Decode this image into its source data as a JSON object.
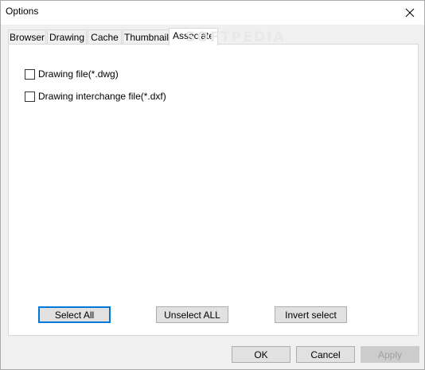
{
  "window": {
    "title": "Options"
  },
  "tabs": [
    {
      "label": "Browser"
    },
    {
      "label": "Drawing"
    },
    {
      "label": "Cache"
    },
    {
      "label": "Thumbnail"
    },
    {
      "label": "Associate"
    }
  ],
  "active_tab": "Associate",
  "associate": {
    "checkboxes": [
      {
        "label": "Drawing file(*.dwg)",
        "checked": false
      },
      {
        "label": "Drawing interchange file(*.dxf)",
        "checked": false
      }
    ],
    "select_all": "Select All",
    "unselect_all": "Unselect ALL",
    "invert_select": "Invert select"
  },
  "footer": {
    "ok": "OK",
    "cancel": "Cancel",
    "apply": "Apply"
  },
  "watermark": "SOFTPEDIA",
  "colors": {
    "accent": "#0078d7",
    "panel_bg": "#ffffff",
    "dialog_bg": "#f0f0f0"
  }
}
